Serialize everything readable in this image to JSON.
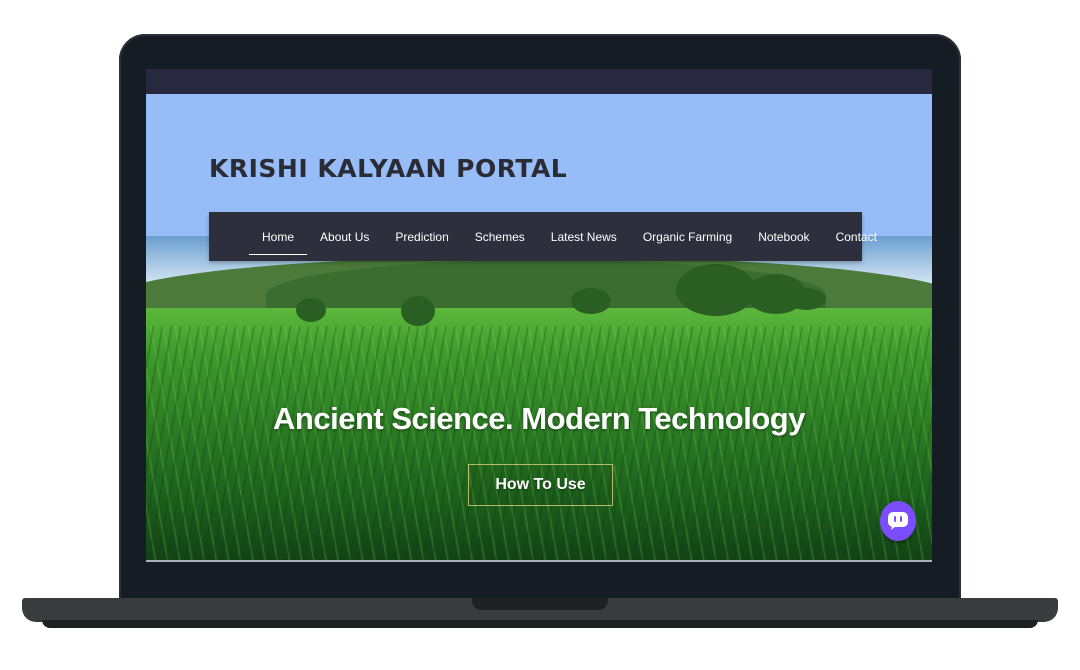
{
  "site": {
    "title": "KRISHI KALYAAN PORTAL"
  },
  "nav": {
    "items": [
      {
        "label": "Home",
        "active": true
      },
      {
        "label": "About Us"
      },
      {
        "label": "Prediction"
      },
      {
        "label": "Schemes"
      },
      {
        "label": "Latest News"
      },
      {
        "label": "Organic Farming"
      },
      {
        "label": "Notebook"
      },
      {
        "label": "Contact"
      }
    ]
  },
  "hero": {
    "heading": "Ancient Science. Modern Technology",
    "cta_label": "How To Use"
  },
  "chat": {
    "icon": "chat-bubble-icon",
    "color": "#7b4dff"
  },
  "colors": {
    "header_bg": "#97bdf8",
    "topbar_bg": "#28283f",
    "nav_bg": "#2d303c"
  }
}
